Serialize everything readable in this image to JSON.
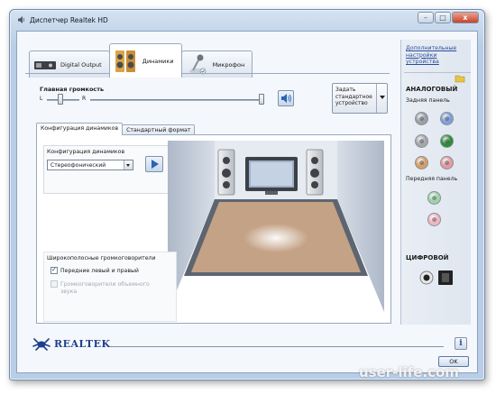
{
  "window": {
    "title": "Диспетчер Realtek HD",
    "minimize_glyph": "–",
    "maximize_glyph": "□",
    "close_glyph": "x"
  },
  "device_tabs": [
    {
      "label": "Digital Output",
      "icon": "digital-output-icon",
      "active": false
    },
    {
      "label": "Динамики",
      "icon": "speakers-icon",
      "active": true
    },
    {
      "label": "Микрофон",
      "icon": "microphone-icon",
      "active": false
    }
  ],
  "volume": {
    "label": "Главная громкость",
    "left_label": "L",
    "right_label": "R",
    "balance": 0.5,
    "level": 1.0
  },
  "default_device_button": {
    "label": "Задать стандартное устройство"
  },
  "config_tabs": [
    {
      "label": "Конфигурация динамиков",
      "active": true
    },
    {
      "label": "Стандартный формат",
      "active": false
    }
  ],
  "speaker_config": {
    "group_label": "Конфигурация динамиков",
    "selected": "Стереофонический"
  },
  "fullrange": {
    "title": "Широкополосные громкоговорители",
    "front_label": "Передние левый и правый",
    "front_checked": true,
    "surround_label": "Громкоговорители объемного звука",
    "surround_checked": false,
    "surround_enabled": false
  },
  "side_panel": {
    "link": "Дополнительные настройки устройства",
    "analog_title": "АНАЛОГОВЫЙ",
    "rear_label": "Задняя панель",
    "front_label": "Передняя панель",
    "digital_title": "ЦИФРОВОЙ",
    "jack_colors": {
      "grey": "#9aa0a6",
      "blue": "#7f9fd6",
      "grey2": "#a4a8ad",
      "green": "#2e8b3a",
      "orange": "#d3a06a",
      "pink": "#e29aa4",
      "green_light": "#9fd3a8",
      "pink_light": "#f0b6bf"
    }
  },
  "footer": {
    "brand": "REALTEK",
    "info_label": "i",
    "ok_label": "OK"
  },
  "watermark": "user-life.com"
}
